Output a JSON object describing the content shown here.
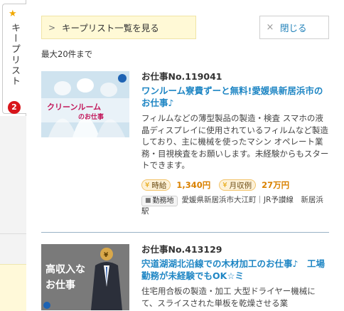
{
  "side_tab": {
    "star": "★",
    "label": "キープリスト",
    "count": "2"
  },
  "header": {
    "keep_list_label": "キープリスト一覧を見る",
    "close_label": "閉じる",
    "max_note": "最大20件まで"
  },
  "jobs": [
    {
      "number": "お仕事No.119041",
      "title": "ワンルーム寮費ずーと無料!愛媛県新居浜市のお仕事♪",
      "description": "フィルムなどの薄型製品の製造・検査 スマホの液晶ディスプレイに使用されているフィルムなど製造しており、主に機械を使ったマシン オペレート業務・目視検査をお願いします。未経験からもスタートできます。",
      "pay_hourly_label": "時給",
      "pay_hourly_value": "1,340円",
      "pay_monthly_label": "月収例",
      "pay_monthly_value": "27万円",
      "location_label": "勤務地",
      "location_text": "愛媛県新居浜市大江町｜JR予讃線　新居浜駅",
      "thumb_caption_1": "クリーンルーム",
      "thumb_caption_2": "のお仕事"
    },
    {
      "number": "お仕事No.413129",
      "title": "宍道湖湖北沿線での木材加工のお仕事♪　工場勤務が未経験でもOK☆ミ",
      "description": "住宅用合板の製造・加工 大型ドライヤー機械にて、スライスされた単板を乾燥させる業",
      "thumb_caption_1": "高収入な",
      "thumb_caption_2": "お仕事"
    }
  ]
}
